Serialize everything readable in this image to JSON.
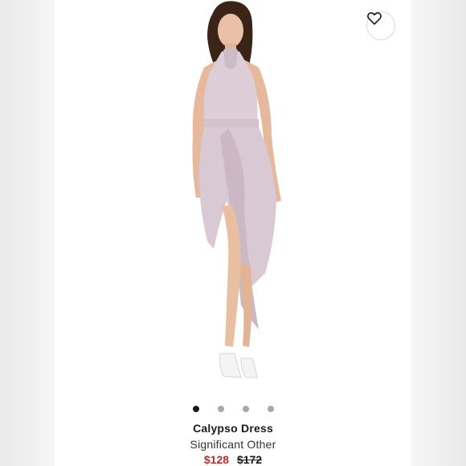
{
  "product": {
    "title": "Calypso Dress",
    "brand": "Significant Other",
    "sale_price": "$128",
    "original_price": "$172"
  },
  "gallery": {
    "image_count": 4,
    "active_index": 0
  },
  "favorite_icon": "heart-outline-icon",
  "colors": {
    "sale_price": "#b5302f",
    "dress": "#d9c9d4",
    "dot_active": "#1a1a1a",
    "dot_inactive": "#a8a8a8"
  }
}
